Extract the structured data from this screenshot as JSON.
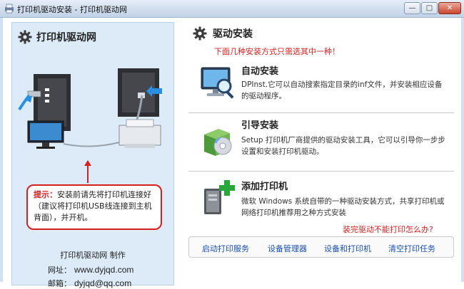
{
  "window": {
    "title": "打印机驱动安装 - 打印机驱动网",
    "min_label": "—",
    "max_label": "□",
    "close_label": "✕"
  },
  "left": {
    "title": "打印机驱动网",
    "tip_label": "提示：",
    "tip_text": "安装前请先将打印机连接好（建议将打印机USB线连接到主机背面），并开机。",
    "credit": "打印机驱动网  制作",
    "web_label": "网址：",
    "web_value": "www.dyjqd.com",
    "email_label": "邮箱：",
    "email_value": "dyjqd@qq.com"
  },
  "right": {
    "title": "驱动安装",
    "notice": "下面几种安装方式只需选其中一种！",
    "methods": [
      {
        "title": "自动安装",
        "desc": "DPInst.它可以自动搜索指定目录的inf文件，并安装相应设备的驱动程序。",
        "icon": "monitor-magnifier-icon"
      },
      {
        "title": "引导安装",
        "desc": "Setup 打印机厂商提供的驱动安装工具，它可以引导你一步步设置和安装打印机驱动。",
        "icon": "setup-box-cd-icon"
      },
      {
        "title": "添加打印机",
        "desc": "微软 Windows 系统自带的一种驱动安装方式，共享打印机或网络打印机推荐用之种方式安装",
        "icon": "add-printer-icon"
      }
    ],
    "problem_link": "装完驱动不能打印怎么办?",
    "bottom_links": [
      "启动打印服务",
      "设备管理器",
      "设备和打印机",
      "清空打印任务"
    ]
  },
  "colors": {
    "accent_red": "#d62020",
    "link_blue": "#1a4fb0",
    "panel_blue": "#dcebf7"
  }
}
